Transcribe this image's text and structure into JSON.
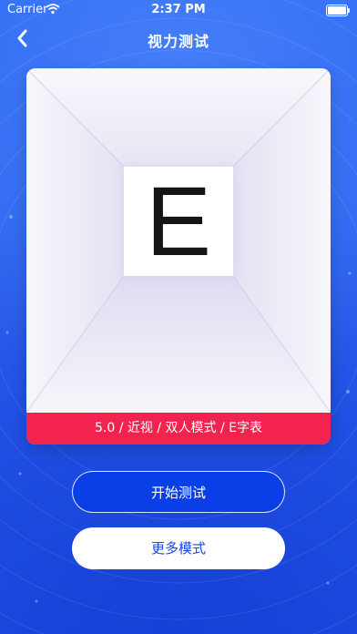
{
  "status_bar": {
    "carrier": "Carrier",
    "time": "2:37 PM"
  },
  "nav": {
    "title": "视力测试",
    "back_icon": "chevron-left-icon"
  },
  "card": {
    "letter": "E",
    "info": "5.0 / 近视 / 双人模式 / E字表"
  },
  "actions": {
    "start_label": "开始测试",
    "more_label": "更多模式"
  },
  "colors": {
    "background": "#2a63f0",
    "info_bar": "#f2244f",
    "primary_button": "#0a3fe8",
    "secondary_text": "#1a49e6"
  }
}
